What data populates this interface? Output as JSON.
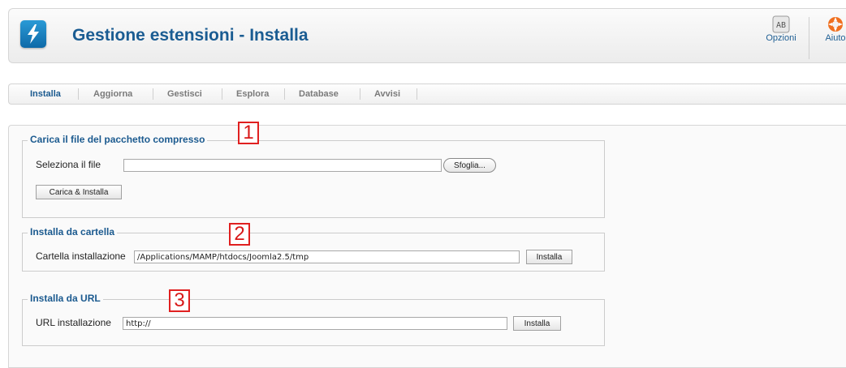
{
  "header": {
    "title": "Gestione estensioni - Installa",
    "options_label": "Opzioni",
    "help_label": "Aiuto"
  },
  "tabs": [
    {
      "label": "Installa",
      "active": true
    },
    {
      "label": "Aggiorna",
      "active": false
    },
    {
      "label": "Gestisci",
      "active": false
    },
    {
      "label": "Esplora",
      "active": false
    },
    {
      "label": "Database",
      "active": false
    },
    {
      "label": "Avvisi",
      "active": false
    }
  ],
  "upload": {
    "legend": "Carica il file del pacchetto compresso",
    "file_label": "Seleziona il file",
    "browse_label": "Sfoglia...",
    "submit_label": "Carica & Installa",
    "callout": "1"
  },
  "folder": {
    "legend": "Installa da cartella",
    "label": "Cartella installazione",
    "value": "/Applications/MAMP/htdocs/Joomla2.5/tmp",
    "submit_label": "Installa",
    "callout": "2"
  },
  "url": {
    "legend": "Installa da URL",
    "label": "URL installazione",
    "value": "http://",
    "submit_label": "Installa",
    "callout": "3"
  },
  "colors": {
    "title": "#1a5c92",
    "callout": "#d81818"
  },
  "icons": {
    "app": "lightning-bolt-icon",
    "options": "options-icon",
    "help": "lifebuoy-icon"
  }
}
